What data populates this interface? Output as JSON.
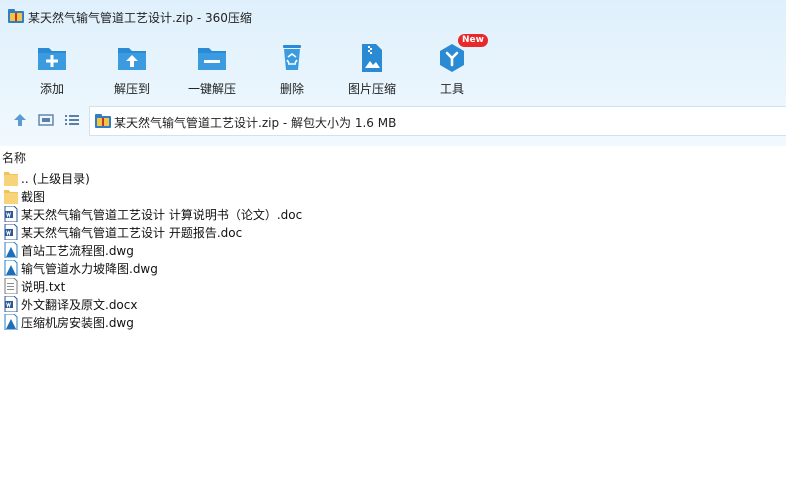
{
  "window": {
    "title": "某天然气输气管道工艺设计.zip - 360压缩",
    "app_icon": "archive-icon"
  },
  "toolbar": {
    "buttons": [
      {
        "label": "添加",
        "icon": "add-file-icon"
      },
      {
        "label": "解压到",
        "icon": "extract-to-icon"
      },
      {
        "label": "一键解压",
        "icon": "one-click-extract-icon"
      },
      {
        "label": "删除",
        "icon": "recycle-bin-icon"
      },
      {
        "label": "图片压缩",
        "icon": "image-compress-icon"
      },
      {
        "label": "工具",
        "icon": "tools-icon",
        "badge": "New"
      }
    ]
  },
  "nav": {
    "up_icon": "arrow-up-icon",
    "view_icon": "thumbnail-view-icon",
    "list_icon": "list-view-icon",
    "path_text": "某天然气输气管道工艺设计.zip - 解包大小为 1.6 MB"
  },
  "file_list": {
    "column_name": "名称",
    "items": [
      {
        "name": ".. (上级目录)",
        "type": "folder"
      },
      {
        "name": "截图",
        "type": "folder"
      },
      {
        "name": "某天然气输气管道工艺设计 计算说明书（论文）.doc",
        "type": "doc"
      },
      {
        "name": "某天然气输气管道工艺设计 开题报告.doc",
        "type": "doc"
      },
      {
        "name": "首站工艺流程图.dwg",
        "type": "dwg"
      },
      {
        "name": "输气管道水力坡降图.dwg",
        "type": "dwg"
      },
      {
        "name": "说明.txt",
        "type": "txt"
      },
      {
        "name": "外文翻译及原文.docx",
        "type": "doc"
      },
      {
        "name": "压缩机房安装图.dwg",
        "type": "dwg"
      }
    ]
  },
  "colors": {
    "accent": "#2a8ad4",
    "header_bg": "#e3f2fd",
    "badge": "#e8282b"
  }
}
